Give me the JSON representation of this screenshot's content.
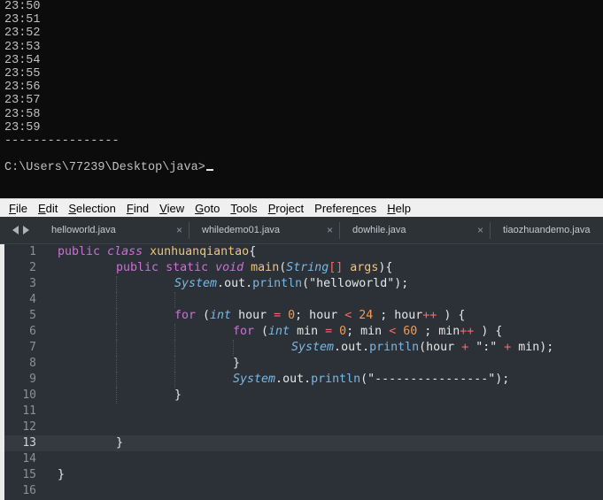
{
  "console": {
    "lines": [
      "23:50",
      "23:51",
      "23:52",
      "23:53",
      "23:54",
      "23:55",
      "23:56",
      "23:57",
      "23:58",
      "23:59",
      "----------------"
    ],
    "prompt": "C:\\Users\\77239\\Desktop\\java>"
  },
  "menubar": {
    "items": [
      {
        "key": "F",
        "rest": "ile"
      },
      {
        "key": "E",
        "rest": "dit"
      },
      {
        "key": "S",
        "rest": "election"
      },
      {
        "key": "F",
        "rest": "ind",
        "pre": ""
      },
      {
        "key": "V",
        "rest": "iew"
      },
      {
        "key": "G",
        "rest": "oto"
      },
      {
        "key": "T",
        "rest": "ools"
      },
      {
        "key": "P",
        "rest": "roject"
      },
      {
        "key": "n",
        "pre": "Prefere",
        "rest": "ces"
      },
      {
        "key": "H",
        "rest": "elp"
      }
    ]
  },
  "tabs": [
    {
      "label": "helloworld.java"
    },
    {
      "label": "whiledemo01.java"
    },
    {
      "label": "dowhile.java"
    },
    {
      "label": "tiaozhuandemo.java"
    }
  ],
  "tab_close_glyph": "×",
  "code": {
    "current_line": 13,
    "lines": [
      {
        "n": "1",
        "indent": 0,
        "tokens": [
          [
            "kw",
            "public"
          ],
          [
            "pun",
            " "
          ],
          [
            "kwi",
            "class"
          ],
          [
            "pun",
            " "
          ],
          [
            "name",
            "xunhuanqiantao"
          ],
          [
            "pun",
            "{"
          ]
        ]
      },
      {
        "n": "2",
        "indent": 1,
        "tokens": [
          [
            "kw",
            "public"
          ],
          [
            "pun",
            " "
          ],
          [
            "kw",
            "static"
          ],
          [
            "pun",
            " "
          ],
          [
            "kwi",
            "void"
          ],
          [
            "pun",
            " "
          ],
          [
            "name",
            "main"
          ],
          [
            "pun",
            "("
          ],
          [
            "typ",
            "String"
          ],
          [
            "op",
            "[]"
          ],
          [
            "pun",
            " "
          ],
          [
            "name",
            "args"
          ],
          [
            "pun",
            "){"
          ]
        ]
      },
      {
        "n": "3",
        "indent": 2,
        "tokens": [
          [
            "cls",
            "System"
          ],
          [
            "pun",
            "."
          ],
          [
            "mem",
            "out"
          ],
          [
            "pun",
            "."
          ],
          [
            "fn",
            "println"
          ],
          [
            "pun",
            "(\"helloworld\");"
          ]
        ]
      },
      {
        "n": "4",
        "indent": 2,
        "tokens": []
      },
      {
        "n": "5",
        "indent": 2,
        "tokens": [
          [
            "kw",
            "for"
          ],
          [
            "pun",
            " ("
          ],
          [
            "typ",
            "int"
          ],
          [
            "pun",
            " hour "
          ],
          [
            "op",
            "="
          ],
          [
            "pun",
            " "
          ],
          [
            "num",
            "0"
          ],
          [
            "pun",
            "; hour "
          ],
          [
            "op",
            "<"
          ],
          [
            "pun",
            " "
          ],
          [
            "num",
            "24"
          ],
          [
            "pun",
            " ; hour"
          ],
          [
            "op",
            "++"
          ],
          [
            "pun",
            " ) {"
          ]
        ]
      },
      {
        "n": "6",
        "indent": 3,
        "tokens": [
          [
            "kw",
            "for"
          ],
          [
            "pun",
            " ("
          ],
          [
            "typ",
            "int"
          ],
          [
            "pun",
            " min "
          ],
          [
            "op",
            "="
          ],
          [
            "pun",
            " "
          ],
          [
            "num",
            "0"
          ],
          [
            "pun",
            "; min "
          ],
          [
            "op",
            "<"
          ],
          [
            "pun",
            " "
          ],
          [
            "num",
            "60"
          ],
          [
            "pun",
            " ; min"
          ],
          [
            "op",
            "++"
          ],
          [
            "pun",
            " ) {"
          ]
        ]
      },
      {
        "n": "7",
        "indent": 4,
        "tokens": [
          [
            "cls",
            "System"
          ],
          [
            "pun",
            "."
          ],
          [
            "mem",
            "out"
          ],
          [
            "pun",
            "."
          ],
          [
            "fn",
            "println"
          ],
          [
            "pun",
            "(hour "
          ],
          [
            "op",
            "+"
          ],
          [
            "pun",
            " \":\" "
          ],
          [
            "op",
            "+"
          ],
          [
            "pun",
            " min);"
          ]
        ]
      },
      {
        "n": "8",
        "indent": 3,
        "tokens": [
          [
            "pun",
            "}"
          ]
        ]
      },
      {
        "n": "9",
        "indent": 3,
        "tokens": [
          [
            "cls",
            "System"
          ],
          [
            "pun",
            "."
          ],
          [
            "mem",
            "out"
          ],
          [
            "pun",
            "."
          ],
          [
            "fn",
            "println"
          ],
          [
            "pun",
            "(\"----------------\");"
          ]
        ]
      },
      {
        "n": "10",
        "indent": 2,
        "tokens": [
          [
            "pun",
            "}"
          ]
        ]
      },
      {
        "n": "11",
        "indent": 0,
        "tokens": []
      },
      {
        "n": "12",
        "indent": 0,
        "tokens": []
      },
      {
        "n": "13",
        "indent": 1,
        "tokens": [
          [
            "pun",
            "}"
          ]
        ]
      },
      {
        "n": "14",
        "indent": 0,
        "tokens": []
      },
      {
        "n": "15",
        "indent": 0,
        "tokens": [
          [
            "pun",
            "}"
          ]
        ]
      },
      {
        "n": "16",
        "indent": 0,
        "tokens": []
      }
    ]
  }
}
